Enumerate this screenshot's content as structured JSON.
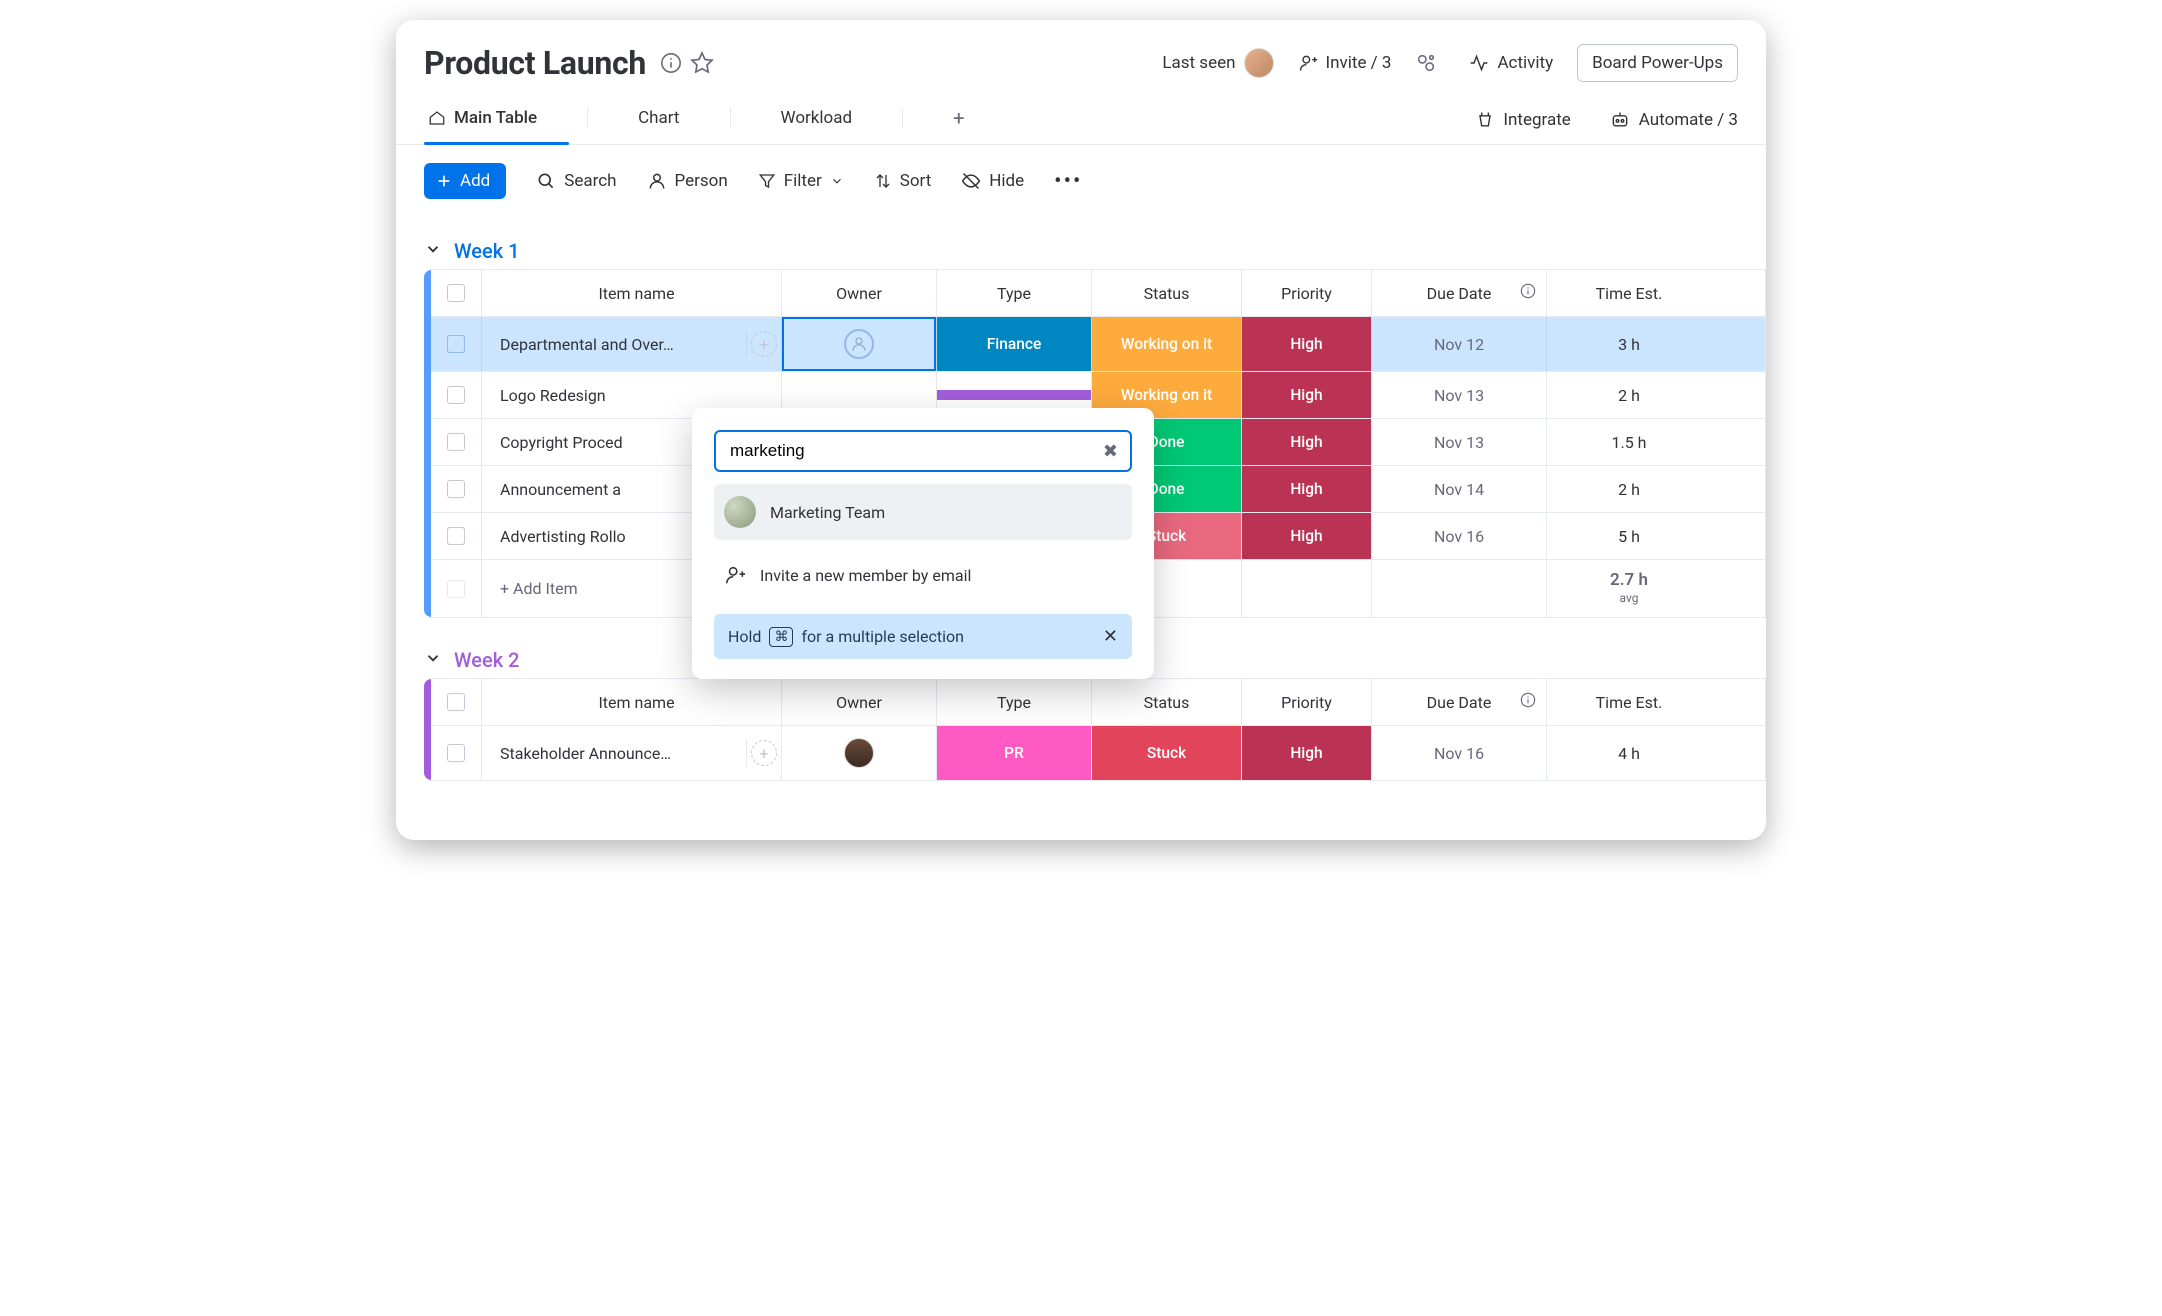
{
  "board": {
    "title": "Product Launch"
  },
  "header": {
    "last_seen_label": "Last seen",
    "invite_label": "Invite / 3",
    "activity_label": "Activity",
    "powerups_label": "Board Power-Ups"
  },
  "tabs": {
    "main": "Main Table",
    "chart": "Chart",
    "workload": "Workload",
    "integrate": "Integrate",
    "automate": "Automate / 3"
  },
  "toolbar": {
    "add": "Add",
    "search": "Search",
    "person": "Person",
    "filter": "Filter",
    "sort": "Sort",
    "hide": "Hide"
  },
  "columns": {
    "item": "Item name",
    "owner": "Owner",
    "type": "Type",
    "status": "Status",
    "priority": "Priority",
    "due": "Due Date",
    "time": "Time Est."
  },
  "groups": [
    {
      "name": "Week 1",
      "color": "#0073ea",
      "summary": {
        "time": "2.7 h",
        "time_sub": "avg"
      },
      "add_item_label": "+ Add Item",
      "rows": [
        {
          "name": "Departmental and Over…",
          "type": "Finance",
          "type_cls": "type-finance",
          "status": "Working on it",
          "status_cls": "status-working",
          "priority": "High",
          "due": "Nov 12",
          "time": "3 h",
          "selected": true,
          "owner_focus": true
        },
        {
          "name": "Logo Redesign",
          "type": "",
          "type_cls": "type-purple",
          "status": "Working on it",
          "status_cls": "status-working",
          "priority": "High",
          "due": "Nov 13",
          "time": "2 h"
        },
        {
          "name": "Copyright Proced",
          "type": "",
          "type_cls": "",
          "status": "Done",
          "status_cls": "status-done",
          "priority": "High",
          "due": "Nov 13",
          "time": "1.5 h"
        },
        {
          "name": "Announcement a",
          "type": "",
          "type_cls": "",
          "status": "Done",
          "status_cls": "status-done",
          "priority": "High",
          "due": "Nov 14",
          "time": "2 h"
        },
        {
          "name": "Advertisting Rollo",
          "type": "",
          "type_cls": "",
          "status": "Stuck",
          "status_cls": "status-stuck",
          "priority": "High",
          "due": "Nov 16",
          "time": "5 h"
        }
      ]
    },
    {
      "name": "Week 2",
      "color": "#a25ddc",
      "rows": [
        {
          "name": "Stakeholder Announce…",
          "type": "PR",
          "type_cls": "type-pr",
          "status": "Stuck",
          "status_cls": "status-stuck2",
          "priority": "High",
          "priority_cls": "priority-high",
          "due": "Nov 16",
          "time": "4 h",
          "has_owner_avatar": true
        }
      ]
    }
  ],
  "popover": {
    "search_value": "marketing",
    "option_team": "Marketing Team",
    "option_invite": "Invite a new member by email",
    "hint_pre": "Hold",
    "hint_key": "⌘",
    "hint_post": "for a multiple selection"
  }
}
